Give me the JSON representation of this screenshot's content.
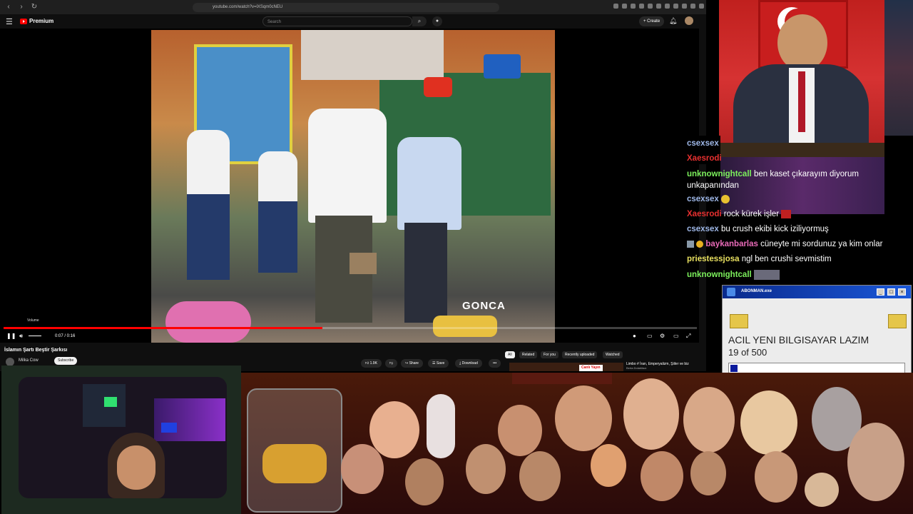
{
  "browser": {
    "url": "youtube.com/watch?v=lXSqm0cNEU"
  },
  "youtube": {
    "logo_text": "Premium",
    "search_placeholder": "Search",
    "create_label": "+ Create"
  },
  "player": {
    "watermark": "GONCA",
    "volume_tooltip": "Volume",
    "time": "0:07 / 0:16",
    "progress": 0.46
  },
  "video": {
    "title": "İslamın Şartı Beştir Şarkısı",
    "channel": "Milka Cow",
    "subscribe_label": "Subscribe",
    "likes": "1.9K",
    "share_label": "Share",
    "save_label": "Save",
    "download_label": "Download",
    "more_label": "•••"
  },
  "chips": [
    "All",
    "Related",
    "For you",
    "Recently uploaded",
    "Watched"
  ],
  "recommendation": {
    "badge": "Canlı Yayın",
    "title": "Limbo # İran, Emperyalizm, Şiiler ve biz",
    "channel": "Berta Dolabitazı"
  },
  "chat": [
    {
      "user": "csexsex",
      "text": "",
      "color": "#9fb8e8"
    },
    {
      "user": "Xaesrodi",
      "text": "",
      "color": "#e83030"
    },
    {
      "user": "unknownightcall",
      "text": "ben kaset çıkarayım diyorum unkapanından",
      "color": "#7cf05c"
    },
    {
      "user": "csexsex",
      "text": "",
      "color": "#9fb8e8"
    },
    {
      "user": "Xaesrodi",
      "text": "rock kürek işler",
      "color": "#e83030"
    },
    {
      "user": "csexsex",
      "text": "bu crush ekibi kick iziliyormuş",
      "color": "#9fb8e8"
    },
    {
      "user": "baykanbarlas",
      "text": "cüneyte mi sordunuz ya kim onlar",
      "color": "#e86ab8"
    },
    {
      "user": "priestessjosa",
      "text": "ngl ben crushi sevmistim",
      "color": "#e8e060"
    },
    {
      "user": "unknownightcall",
      "text": "",
      "color": "#7cf05c"
    }
  ],
  "popup": {
    "title": "ABONMAN.exe",
    "message": "ACIL YENI BILGISAYAR LAZIM",
    "count_text": "19 of 500",
    "progress": 0.038
  },
  "colors": {
    "yt_red": "#ff0000",
    "popup_title": "#0a2a8c"
  }
}
